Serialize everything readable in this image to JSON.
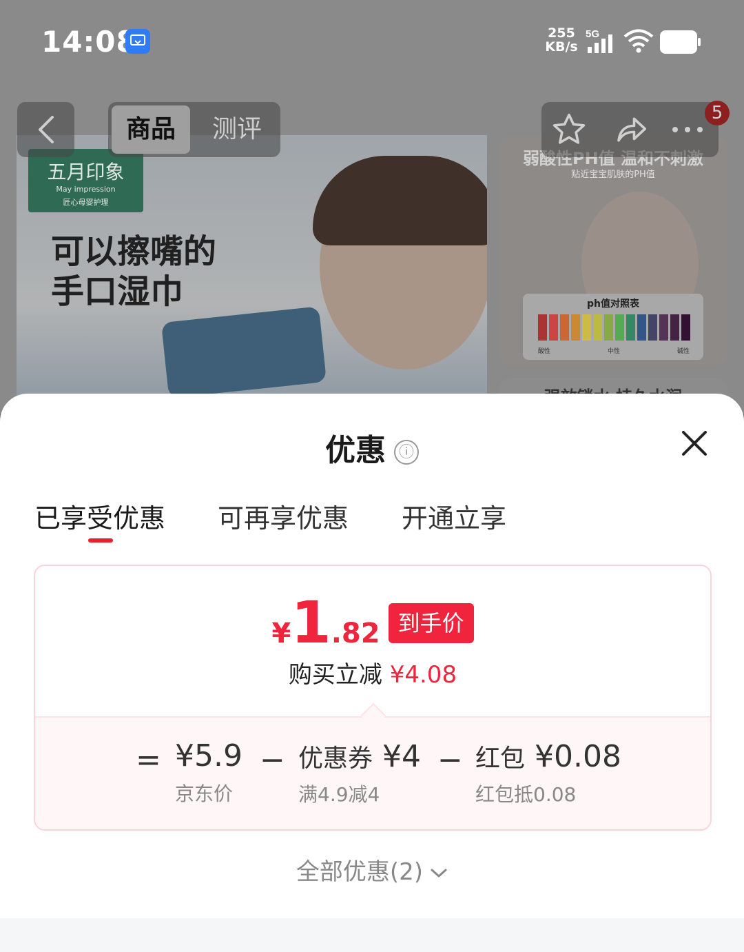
{
  "status_bar": {
    "time": "14:08",
    "net_speed_value": "255",
    "net_speed_unit": "KB/s",
    "network_type": "5G",
    "icons": [
      "screen-cast-icon",
      "signal-icon",
      "wifi-icon",
      "battery-icon"
    ]
  },
  "product_nav": {
    "tabs": [
      {
        "label": "商品",
        "active": true
      },
      {
        "label": "测评",
        "active": false
      }
    ],
    "cart_badge": "5",
    "icons": [
      "back-icon",
      "star-icon",
      "share-icon",
      "more-icon"
    ]
  },
  "hero": {
    "brand_cn": "五月印象",
    "brand_en": "May impression",
    "brand_tagline": "匠心母婴护理",
    "headline_line1": "可以擦嘴的",
    "headline_line2": "手口湿巾",
    "side_title": "弱酸性PH值 温和不刺激",
    "side_subtitle": "贴近宝宝肌肤的PH值",
    "ph_chart_title": "ph值对照表",
    "ph_labels": [
      "酸性",
      "中性",
      "碱性"
    ],
    "side2_title": "强效锁水 持久水润"
  },
  "sheet": {
    "title": "优惠",
    "info_icon": "ⓘ",
    "tabs": [
      {
        "label": "已享受优惠",
        "active": true
      },
      {
        "label": "可再享优惠",
        "active": false
      },
      {
        "label": "开通立享",
        "active": false
      }
    ],
    "final": {
      "currency": "¥",
      "price_int": "1",
      "price_dec": ".82",
      "tag": "到手价",
      "discount_label": "购买立减",
      "discount_amount": "¥4.08"
    },
    "breakdown": {
      "equals": "=",
      "minus": "−",
      "jd_price": "¥5.9",
      "jd_label": "京东价",
      "coupon_label": "优惠券",
      "coupon_amount": "¥4",
      "coupon_rule": "满4.9减4",
      "redpack_label": "红包",
      "redpack_amount": "¥0.08",
      "redpack_rule": "红包抵0.08"
    },
    "all_offers": "全部优惠(2)"
  },
  "colors": {
    "accent_red": "#f0243c",
    "card_border": "#fbd3da",
    "breakdown_bg": "#fff6f7"
  }
}
